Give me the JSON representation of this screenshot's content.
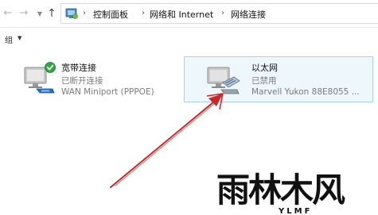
{
  "address_bar": {
    "crumbs": [
      "控制面板",
      "网络和 Internet",
      "网络连接"
    ]
  },
  "toolbar": {
    "organize_label": "组"
  },
  "connections": [
    {
      "name": "宽带连接",
      "status": "已断开连接",
      "device": "WAN Miniport (PPPOE)",
      "state_icon": "green-check-icon"
    },
    {
      "name": "以太网",
      "status": "已禁用",
      "device": "Marvell Yukon 88E8055 ...",
      "selected": true
    }
  ],
  "annotation": {
    "color": "#c8282a",
    "points_to": "以太网"
  },
  "watermark": {
    "text": "雨林木风",
    "subtext": "YLMF"
  },
  "colors": {
    "selection_bg": "#eef7fc",
    "selection_border": "#a9d3ec",
    "status_text": "#7a7a7a"
  }
}
